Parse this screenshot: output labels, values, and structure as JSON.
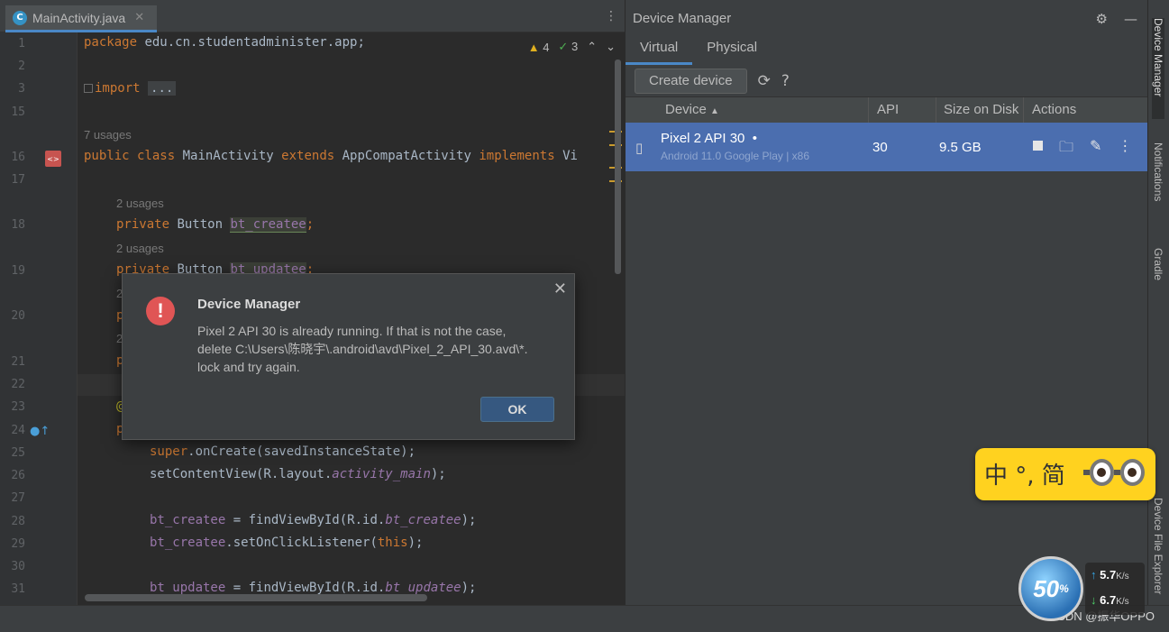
{
  "editor": {
    "tab": {
      "icon_letter": "C",
      "filename": "MainActivity.java",
      "close": "✕"
    },
    "menu": "⋮",
    "problems": {
      "warn_icon": "▲",
      "warnings": "4",
      "ok_icon": "✓",
      "weak_warnings": "3",
      "up": "⌃",
      "down": "⌄"
    },
    "gutter_lines": [
      "1",
      "2",
      "3",
      "15",
      "",
      "16",
      "17",
      "",
      "18",
      "",
      "19",
      "",
      "20",
      "",
      "21",
      "22",
      "23",
      "24",
      "25",
      "26",
      "27",
      "28",
      "29",
      "30",
      "31"
    ],
    "lines": {
      "l1_kw": "package",
      "l1_rest": " edu.cn.studentadminister.app;",
      "l3_kw": "import",
      "l3_ellipsis": "...",
      "usages7": "7 usages",
      "l16_kw1": "public class",
      "l16_mid1": " MainActivity ",
      "l16_kw2": "extends",
      "l16_mid2": " AppCompatActivity ",
      "l16_kw3": "implements",
      "l16_rest": " Vi",
      "usages2": "2 usages",
      "l18_kw": "private",
      "l18_type": " Button ",
      "l18_field": "bt_createe",
      "l19_kw": "private",
      "l19_type": " Button ",
      "l19_field": "bt_updatee",
      "frag_p": "p",
      "frag_2": "2",
      "frag_at": "@",
      "l25_kw": "super",
      "l25_rest": ".onCreate(savedInstanceState);",
      "l26_a": "setContentView(R.layout.",
      "l26_it": "activity_main",
      "l26_b": ");",
      "l28_fld": "bt_createe",
      "l28_a": " = findViewById(R.id.",
      "l28_it": "bt_createe",
      "l28_b": ");",
      "l29_fld": "bt_createe",
      "l29_a": ".setOnClickListener(",
      "l29_kw": "this",
      "l29_b": ");",
      "l31_fld": "bt_updatee",
      "l31_a": " = findViewById(R.id.",
      "l31_it": "bt_updatee",
      "l31_b": ");"
    }
  },
  "device_manager": {
    "title": "Device Manager",
    "header_icons": {
      "settings": "⚙",
      "minimize": "—"
    },
    "tabs": [
      "Virtual",
      "Physical"
    ],
    "create_button": "Create device",
    "refresh_icon": "⟳",
    "help_icon": "?",
    "columns": {
      "device": "Device",
      "sort": "▲",
      "api": "API",
      "size": "Size on Disk",
      "actions": "Actions"
    },
    "device": {
      "name": "Pixel 2 API 30",
      "status_dot": "•",
      "subtitle": "Android 11.0 Google Play | x86",
      "api": "30",
      "size": "9.5 GB",
      "folder_icon": "🗀",
      "edit_icon": "✎",
      "more_icon": "⋮"
    }
  },
  "side_tools": [
    "Device Manager",
    "Notifications",
    "Gradle",
    "Device File Explorer"
  ],
  "dialog": {
    "title": "Device Manager",
    "icon": "!",
    "message_line1": "Pixel 2 API 30 is already running. If that is not the case,",
    "message_line2": "delete C:\\Users\\陈晓宇\\.android\\avd\\Pixel_2_API_30.avd\\*.",
    "message_line3": "lock and try again.",
    "ok": "OK",
    "close": "✕"
  },
  "ime": {
    "text": "中 °, 简"
  },
  "netmon": {
    "percent": "50",
    "percent_sign": "%",
    "up_arrow": "↑",
    "up": "5.7",
    "down_arrow": "↓",
    "down": "6.7",
    "unit": "K/s"
  },
  "watermark": "CSDN @振华OPPO",
  "colors": {
    "accent": "#4a88c7",
    "selected_row": "#4b6eaf",
    "keyword": "#cc7832",
    "field": "#9876aa",
    "error": "#e05555",
    "ime_bg": "#ffd21f"
  }
}
